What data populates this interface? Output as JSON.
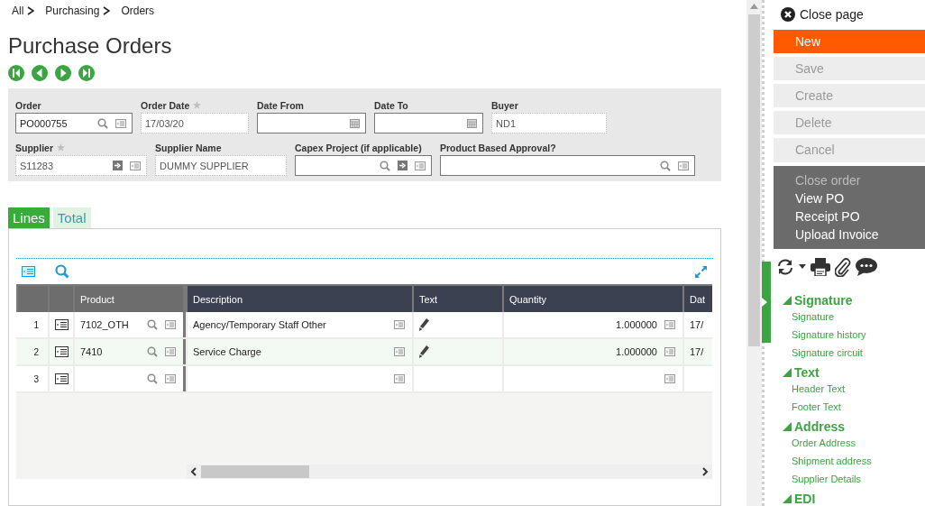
{
  "breadcrumb": [
    {
      "label": "All"
    },
    {
      "label": "Purchasing"
    },
    {
      "label": "Orders"
    }
  ],
  "title": "Purchase Orders",
  "form": {
    "fields": [
      {
        "label": "Order",
        "kind": "lookup",
        "value": "PO000755",
        "readonly": false,
        "required": false
      },
      {
        "label": "Order Date",
        "kind": "text",
        "value": "17/03/20",
        "readonly": true,
        "required": true
      },
      {
        "label": "Date From",
        "kind": "date",
        "readonly": false,
        "required": false
      },
      {
        "label": "Date To",
        "kind": "date",
        "readonly": false,
        "required": false
      },
      {
        "label": "Buyer",
        "kind": "text",
        "value": "ND1",
        "readonly": true,
        "required": false
      },
      {
        "label": "Supplier",
        "kind": "link",
        "value": "S11283",
        "readonly": true,
        "required": true
      },
      {
        "label": "Supplier Name",
        "kind": "text",
        "value": "DUMMY SUPPLIER",
        "readonly": true,
        "required": false
      },
      {
        "label": "Capex Project (if applicable)",
        "kind": "project",
        "readonly": false,
        "required": false
      },
      {
        "label": "Product Based Approval?",
        "kind": "lookup",
        "readonly": false,
        "required": false
      }
    ]
  },
  "tabs": [
    {
      "label": "Lines",
      "selected": true
    },
    {
      "label": "Total",
      "selected": false
    }
  ],
  "table": {
    "columns": [
      "Product",
      "Description",
      "Text",
      "Quantity",
      "Dat"
    ],
    "rows": [
      {
        "number": "1",
        "product": "7102_OTH",
        "description": "Agency/Temporary Staff Other",
        "has_text": true,
        "quantity": "1.000000",
        "date": "17/"
      },
      {
        "number": "2",
        "product": "7410",
        "description": "Service Charge",
        "has_text": true,
        "quantity": "1.000000",
        "date": "17/"
      },
      {
        "number": "3",
        "has_text": false
      }
    ]
  },
  "sidebar": {
    "close": "Close page",
    "actions": [
      {
        "label": "New",
        "primary": true,
        "disabled": false
      },
      {
        "label": "Save",
        "primary": false,
        "disabled": true
      },
      {
        "label": "Create",
        "primary": false,
        "disabled": true
      },
      {
        "label": "Delete",
        "primary": false,
        "disabled": true
      },
      {
        "label": "Cancel",
        "primary": false,
        "disabled": true
      }
    ],
    "menu": [
      {
        "label": "Close order",
        "disabled": true
      },
      {
        "label": "View PO",
        "disabled": false
      },
      {
        "label": "Receipt PO",
        "disabled": false
      },
      {
        "label": "Upload Invoice",
        "disabled": false
      }
    ],
    "sections": [
      {
        "title": "Signature",
        "expanded": true,
        "children": [
          {
            "label": "Signature"
          },
          {
            "label": "Signature history"
          },
          {
            "label": "Signature circuit"
          }
        ]
      },
      {
        "title": "Text",
        "expanded": true,
        "children": [
          {
            "label": "Header Text"
          },
          {
            "label": "Footer Text"
          }
        ]
      },
      {
        "title": "Address",
        "expanded": true,
        "children": [
          {
            "label": "Order Address"
          },
          {
            "label": "Shipment address"
          },
          {
            "label": "Supplier Details"
          }
        ]
      },
      {
        "title": "EDI",
        "expanded": true
      }
    ]
  }
}
